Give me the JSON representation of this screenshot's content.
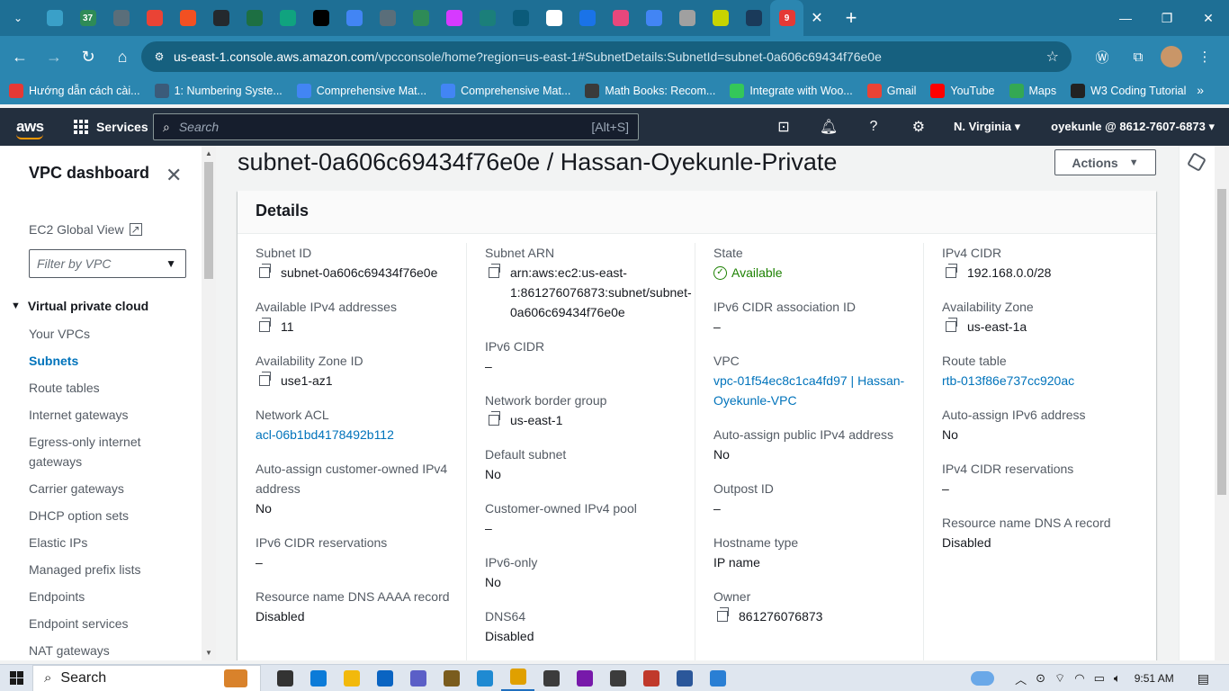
{
  "browser": {
    "tabs": [
      {
        "icon": "chevron-down-icon",
        "color": "#1e6f95"
      },
      {
        "icon": "tab-favicon",
        "color": "#3aa0c8"
      },
      {
        "icon": "tab-favicon",
        "color": "#2e8b57",
        "label": "37"
      },
      {
        "icon": "tab-favicon",
        "color": "#5a6e7a"
      },
      {
        "icon": "gmail-icon",
        "color": "#ea4335"
      },
      {
        "icon": "microsoft-icon",
        "color": "#f25022"
      },
      {
        "icon": "github-icon",
        "color": "#24292e"
      },
      {
        "icon": "excel-icon",
        "color": "#1d6f42"
      },
      {
        "icon": "chatgpt-icon",
        "color": "#10a37f"
      },
      {
        "icon": "x-icon",
        "color": "#000000"
      },
      {
        "icon": "google-icon",
        "color": "#4285f4"
      },
      {
        "icon": "tab-favicon",
        "color": "#5a6e7a"
      },
      {
        "icon": "tab-favicon",
        "color": "#2e8b57"
      },
      {
        "icon": "tab-favicon",
        "color": "#d63aff"
      },
      {
        "icon": "tab-favicon",
        "color": "#1b7f7a"
      },
      {
        "icon": "tab-favicon",
        "color": "#0b5b7a"
      },
      {
        "icon": "tab-favicon",
        "color": "#ffffff"
      },
      {
        "icon": "tab-favicon",
        "color": "#1a73e8"
      },
      {
        "icon": "tab-favicon",
        "color": "#e8477c"
      },
      {
        "icon": "google-icon",
        "color": "#4285f4"
      },
      {
        "icon": "tab-favicon",
        "color": "#a0a0a0"
      },
      {
        "icon": "tab-favicon",
        "color": "#c8d400"
      },
      {
        "icon": "tab-favicon",
        "color": "#1a3a5a"
      },
      {
        "icon": "tab-favicon",
        "color": "#e53935",
        "label": "9"
      }
    ],
    "url_host": "us-east-1.console.aws.amazon.com",
    "url_rest": "/vpcconsole/home?region=us-east-1#SubnetDetails:SubnetId=subnet-0a606c69434f76e0e",
    "bookmarks": [
      {
        "label": "Hướng dẫn cách cài...",
        "icon_color": "#e53935"
      },
      {
        "label": "1: Numbering Syste...",
        "icon_color": "#3b5b7a"
      },
      {
        "label": "Comprehensive Mat...",
        "icon_color": "#4285f4"
      },
      {
        "label": "Comprehensive Mat...",
        "icon_color": "#4285f4"
      },
      {
        "label": "Math Books: Recom...",
        "icon_color": "#3a3a3a"
      },
      {
        "label": "Integrate with Woo...",
        "icon_color": "#34c759"
      },
      {
        "label": "Gmail",
        "icon_color": "#ea4335"
      },
      {
        "label": "YouTube",
        "icon_color": "#ff0000"
      },
      {
        "label": "Maps",
        "icon_color": "#34a853"
      },
      {
        "label": "W3 Coding Tutorial",
        "icon_color": "#222222"
      }
    ]
  },
  "aws": {
    "logo": "aws",
    "services": "Services",
    "search_placeholder": "Search",
    "search_shortcut": "[Alt+S]",
    "region": "N. Virginia",
    "account": "oyekunle @ 8612-7607-6873"
  },
  "sidebar": {
    "title": "VPC dashboard",
    "global_view": "EC2 Global View",
    "filter_placeholder": "Filter by VPC",
    "section": "Virtual private cloud",
    "items": [
      {
        "label": "Your VPCs",
        "active": false
      },
      {
        "label": "Subnets",
        "active": true
      },
      {
        "label": "Route tables",
        "active": false
      },
      {
        "label": "Internet gateways",
        "active": false
      },
      {
        "label": "Egress-only internet gateways",
        "active": false
      },
      {
        "label": "Carrier gateways",
        "active": false
      },
      {
        "label": "DHCP option sets",
        "active": false
      },
      {
        "label": "Elastic IPs",
        "active": false
      },
      {
        "label": "Managed prefix lists",
        "active": false
      },
      {
        "label": "Endpoints",
        "active": false
      },
      {
        "label": "Endpoint services",
        "active": false
      },
      {
        "label": "NAT gateways",
        "active": false
      }
    ]
  },
  "main": {
    "title": "subnet-0a606c69434f76e0e / Hassan-Oyekunle-Private",
    "actions": "Actions",
    "details_title": "Details",
    "columns": [
      [
        {
          "key": "Subnet ID",
          "value": "subnet-0a606c69434f76e0e",
          "copy": true
        },
        {
          "key": "Available IPv4 addresses",
          "value": "11",
          "copy": true
        },
        {
          "key": "Availability Zone ID",
          "value": "use1-az1",
          "copy": true
        },
        {
          "key": "Network ACL",
          "value": "acl-06b1bd4178492b112",
          "link": true
        },
        {
          "key": "Auto-assign customer-owned IPv4 address",
          "value": "No"
        },
        {
          "key": "IPv6 CIDR reservations",
          "value": "–"
        },
        {
          "key": "Resource name DNS AAAA record",
          "value": "Disabled"
        }
      ],
      [
        {
          "key": "Subnet ARN",
          "value": "arn:aws:ec2:us-east-1:861276076873:subnet/subnet-0a606c69434f76e0e",
          "copy": true
        },
        {
          "key": "IPv6 CIDR",
          "value": "–"
        },
        {
          "key": "Network border group",
          "value": "us-east-1",
          "copy": true
        },
        {
          "key": "Default subnet",
          "value": "No"
        },
        {
          "key": "Customer-owned IPv4 pool",
          "value": "–"
        },
        {
          "key": "IPv6-only",
          "value": "No"
        },
        {
          "key": "DNS64",
          "value": "Disabled"
        }
      ],
      [
        {
          "key": "State",
          "value": "Available",
          "status": "ok"
        },
        {
          "key": "IPv6 CIDR association ID",
          "value": "–"
        },
        {
          "key": "VPC",
          "value": "vpc-01f54ec8c1ca4fd97 | Hassan-Oyekunle-VPC",
          "link": true
        },
        {
          "key": "Auto-assign public IPv4 address",
          "value": "No"
        },
        {
          "key": "Outpost ID",
          "value": "–"
        },
        {
          "key": "Hostname type",
          "value": "IP name"
        },
        {
          "key": "Owner",
          "value": "861276076873",
          "copy": true
        }
      ],
      [
        {
          "key": "IPv4 CIDR",
          "value": "192.168.0.0/28",
          "copy": true
        },
        {
          "key": "Availability Zone",
          "value": "us-east-1a",
          "copy": true
        },
        {
          "key": "Route table",
          "value": "rtb-013f86e737cc920ac",
          "link": true
        },
        {
          "key": "Auto-assign IPv6 address",
          "value": "No"
        },
        {
          "key": "IPv4 CIDR reservations",
          "value": "–"
        },
        {
          "key": "Resource name DNS A record",
          "value": "Disabled"
        }
      ]
    ]
  },
  "taskbar": {
    "search": "Search",
    "time": "9:51 AM",
    "apps": [
      {
        "icon": "task-view-icon",
        "color": "#333333"
      },
      {
        "icon": "edge-icon",
        "color": "#0c7bd8"
      },
      {
        "icon": "file-explorer-icon",
        "color": "#f2b90c"
      },
      {
        "icon": "outlook-icon",
        "color": "#0a64c2"
      },
      {
        "icon": "teams-icon",
        "color": "#5b5fc7"
      },
      {
        "icon": "app-icon",
        "color": "#7a5c1e"
      },
      {
        "icon": "vscode-icon",
        "color": "#1f8ad2"
      },
      {
        "icon": "chrome-icon",
        "color": "#e0a000"
      },
      {
        "icon": "app-icon",
        "color": "#3c3c3c"
      },
      {
        "icon": "onenote-icon",
        "color": "#7719aa"
      },
      {
        "icon": "app-icon",
        "color": "#3c3c3c"
      },
      {
        "icon": "app-icon",
        "color": "#c0392b"
      },
      {
        "icon": "word-icon",
        "color": "#2b579a"
      },
      {
        "icon": "photos-icon",
        "color": "#2a7fd4"
      }
    ]
  }
}
